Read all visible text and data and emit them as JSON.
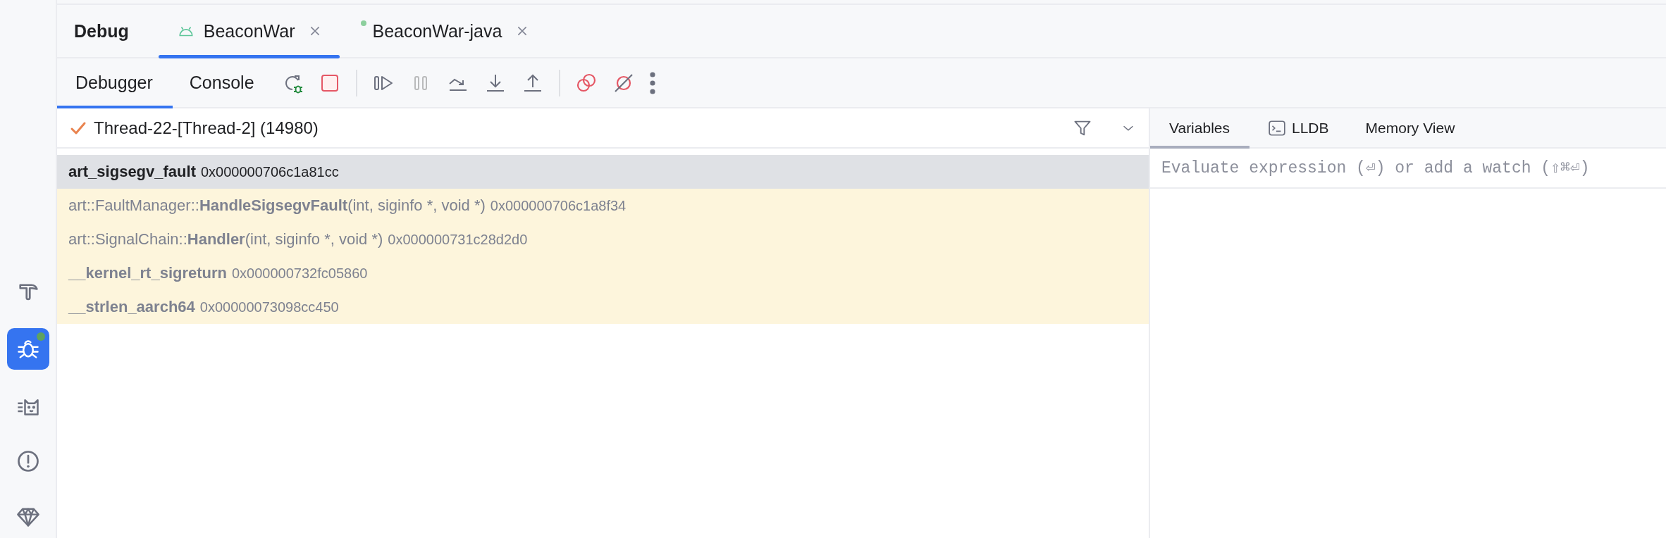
{
  "sidebar": [
    {
      "kind": "build",
      "selected": false,
      "notification": false
    },
    {
      "kind": "debug",
      "selected": true,
      "notification": true
    },
    {
      "kind": "logcat",
      "selected": false,
      "notification": false
    },
    {
      "kind": "problems",
      "selected": false,
      "notification": false
    },
    {
      "kind": "gem",
      "selected": false,
      "notification": false
    }
  ],
  "panel_title": "Debug",
  "session_tabs": [
    {
      "label": "BeaconWar",
      "kind": "android",
      "selected": true
    },
    {
      "label": "BeaconWar-java",
      "kind": "dot",
      "selected": false
    }
  ],
  "view_tabs": [
    {
      "label": "Debugger",
      "selected": true
    },
    {
      "label": "Console",
      "selected": false
    }
  ],
  "toolbar": [
    {
      "kind": "rerun",
      "disabled": false
    },
    {
      "kind": "stop",
      "disabled": false
    },
    {
      "kind": "separator"
    },
    {
      "kind": "resume",
      "disabled": false
    },
    {
      "kind": "pause",
      "disabled": true
    },
    {
      "kind": "step-over",
      "disabled": false
    },
    {
      "kind": "step-into",
      "disabled": false
    },
    {
      "kind": "step-out",
      "disabled": false
    },
    {
      "kind": "separator"
    },
    {
      "kind": "breakpoints",
      "disabled": false
    },
    {
      "kind": "mute",
      "disabled": false
    },
    {
      "kind": "more",
      "disabled": false
    }
  ],
  "thread": {
    "label": "Thread-22-[Thread-2] (14980)"
  },
  "frames": [
    {
      "name": "**art_sigsegv_fault**",
      "address": "0x000000706c1a81cc",
      "selected": true,
      "library": false
    },
    {
      "name": "art::FaultManager::**HandleSigsegvFault**(int, siginfo *, void *)",
      "address": "0x000000706c1a8f34",
      "selected": false,
      "library": true
    },
    {
      "name": "art::SignalChain::**Handler**(int, siginfo *, void *)",
      "address": "0x000000731c28d2d0",
      "selected": false,
      "library": true
    },
    {
      "name": "**__kernel_rt_sigreturn**",
      "address": "0x000000732fc05860",
      "selected": false,
      "library": true
    },
    {
      "name": "**__strlen_aarch64**",
      "address": "0x00000073098cc450",
      "selected": false,
      "library": true
    }
  ],
  "detail_tabs": [
    {
      "label": "Variables",
      "kind": "plain",
      "selected": true
    },
    {
      "label": "LLDB",
      "kind": "terminal",
      "selected": false
    },
    {
      "label": "Memory View",
      "kind": "plain",
      "selected": false
    }
  ],
  "evaluate": {
    "placeholder": "Evaluate expression (⏎) or add a watch (⇧⌘⏎)"
  }
}
